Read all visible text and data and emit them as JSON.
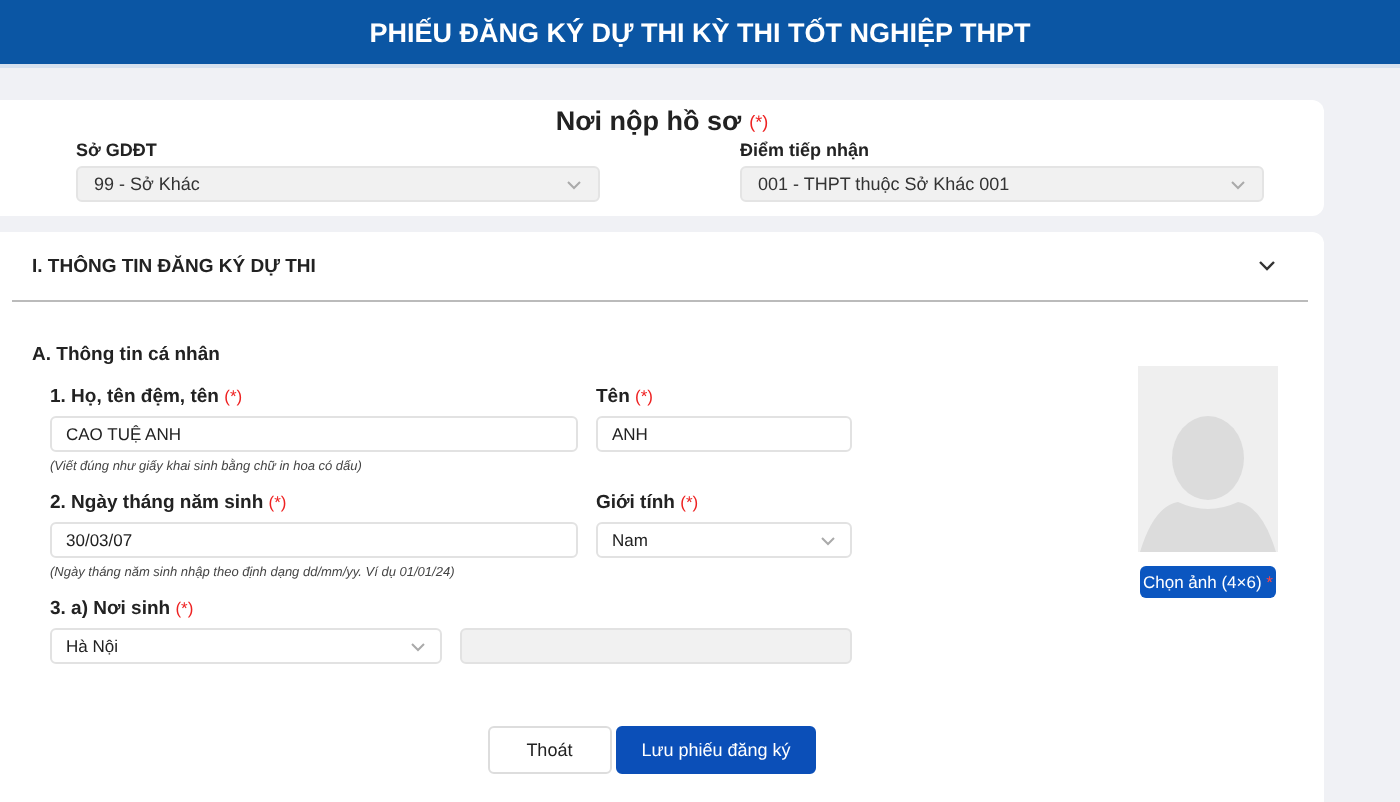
{
  "header": {
    "title": "PHIẾU ĐĂNG KÝ DỰ THI KỲ THI TỐT NGHIỆP THPT"
  },
  "submission": {
    "title": "Nơi nộp hồ sơ",
    "required_mark": "(*)",
    "fields": [
      {
        "label": "Sở GDĐT",
        "value": "99 - Sở Khác",
        "kind": "select",
        "disabled": true
      },
      {
        "label": "Điểm tiếp nhận",
        "value": "001 - THPT thuộc Sở Khác 001",
        "kind": "select",
        "disabled": true
      }
    ]
  },
  "section": {
    "title": "I. THÔNG TIN ĐĂNG KÝ DỰ THI",
    "expanded": true,
    "subtitle": "A. Thông tin cá nhân",
    "rows": [
      {
        "fields": [
          {
            "label": "1. Họ, tên đệm, tên",
            "required_mark": "(*)",
            "value": "CAO TUỆ ANH",
            "kind": "text",
            "disabled": false
          },
          {
            "label": "Tên",
            "required_mark": "(*)",
            "value": "ANH",
            "kind": "text",
            "disabled": false
          }
        ],
        "hint": "(Viết đúng như giấy khai sinh bằng chữ in hoa có dấu)"
      },
      {
        "fields": [
          {
            "label": "2. Ngày tháng năm sinh",
            "required_mark": "(*)",
            "value": "30/03/07",
            "kind": "text",
            "disabled": false
          },
          {
            "label": "Giới tính",
            "required_mark": "(*)",
            "value": "Nam",
            "kind": "select",
            "disabled": false
          }
        ],
        "hint": "(Ngày tháng năm sinh nhập theo định dạng dd/mm/yy. Ví dụ 01/01/24)"
      },
      {
        "fields": [
          {
            "label": "3. a) Nơi sinh",
            "required_mark": "(*)",
            "value": "Hà Nội",
            "kind": "select",
            "disabled": false
          },
          {
            "kind": "text",
            "disabled": true
          }
        ]
      }
    ],
    "photo": {
      "button": "Chọn ảnh (4×6)",
      "required_mark": "*"
    }
  },
  "buttons": [
    {
      "label": "Thoát",
      "primary": false
    },
    {
      "label": "Lưu phiếu đăng ký",
      "primary": true
    }
  ]
}
